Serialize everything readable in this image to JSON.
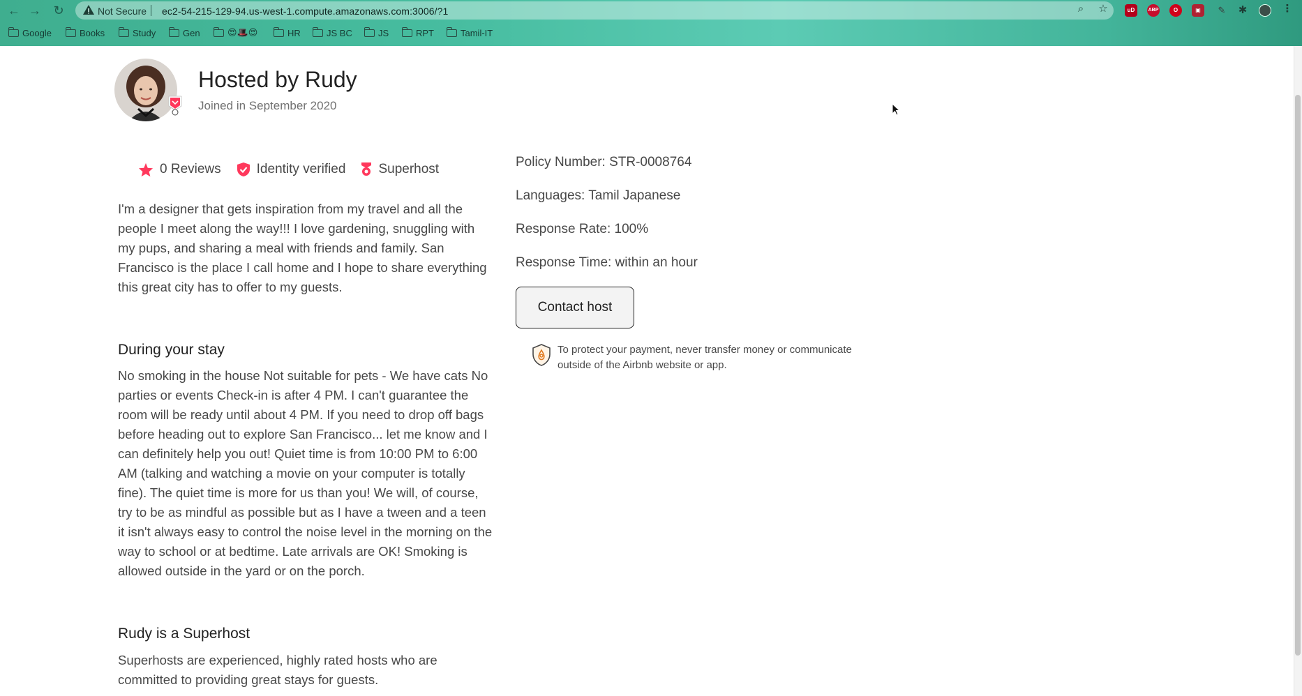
{
  "browser": {
    "security_label": "Not Secure",
    "url": "ec2-54-215-129-94.us-west-1.compute.amazonaws.com:3006/?1",
    "bookmarks": [
      {
        "label": "Google"
      },
      {
        "label": "Books"
      },
      {
        "label": "Study"
      },
      {
        "label": "Gen"
      },
      {
        "label": "😍🎩😍"
      },
      {
        "label": "HR"
      },
      {
        "label": "JS BC"
      },
      {
        "label": "JS"
      },
      {
        "label": "RPT"
      },
      {
        "label": "Tamil-IT"
      }
    ],
    "extensions": [
      {
        "name": "ublock-icon",
        "label": "uD",
        "color": "#b3001b"
      },
      {
        "name": "adblock-plus-icon",
        "label": "ABP",
        "color": "#c70d2c"
      },
      {
        "name": "opera-extension-icon",
        "label": "O",
        "color": "#d0021b"
      },
      {
        "name": "image-extension-icon",
        "label": "▣",
        "color": "#b02232"
      },
      {
        "name": "pen-extension-icon",
        "label": "✎",
        "color": "#4a4a4a"
      },
      {
        "name": "puzzle-icon",
        "label": "✱",
        "color": "#1d3d35"
      }
    ]
  },
  "host": {
    "title": "Hosted by Rudy",
    "joined": "Joined in September 2020",
    "stats": {
      "reviews": "0 Reviews",
      "identity": "Identity verified",
      "superhost": "Superhost"
    },
    "about": "I'm a designer that gets inspiration from my travel and all the people I meet along the way!!! I love gardening, snuggling with my pups, and sharing a meal with friends and family. San Francisco is the place I call home and I hope to share everything this great city has to offer to my guests.",
    "during_stay": {
      "heading": "During your stay",
      "text": "No smoking in the house Not suitable for pets - We have cats No parties or events Check-in is after 4 PM. I can't guarantee the room will be ready until about 4 PM. If you need to drop off bags before heading out to explore San Francisco... let me know and I can definitely help you out! Quiet time is from 10:00 PM to 6:00 AM (talking and watching a movie on your computer is totally fine). The quiet time is more for us than you! We will, of course, try to be as mindful as possible but as I have a tween and a teen it isn't always easy to control the noise level in the morning on the way to school or at bedtime. Late arrivals are OK! Smoking is allowed outside in the yard or on the porch."
    },
    "superhost_section": {
      "heading": "Rudy is a Superhost",
      "text": "Superhosts are experienced, highly rated hosts who are committed to providing great stays for guests."
    },
    "details": {
      "policy": "Policy Number: STR-0008764",
      "languages": "Languages: Tamil Japanese",
      "response_rate": "Response Rate: 100%",
      "response_time": "Response Time: within an hour"
    },
    "contact_button": "Contact host",
    "protect_notice": "To protect your payment, never transfer money or communicate outside of the Airbnb website or app."
  },
  "colors": {
    "brand": "#FF385C",
    "text": "#484848",
    "heading": "#222222",
    "muted": "#717171"
  }
}
